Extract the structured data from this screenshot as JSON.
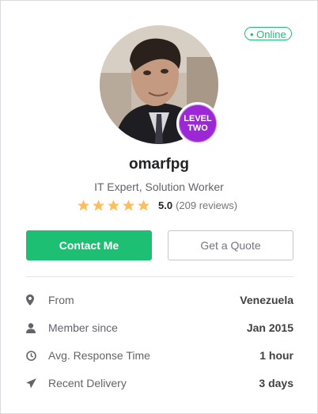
{
  "profile": {
    "status": "• Online",
    "level_line1": "LEVEL",
    "level_line2": "TWO",
    "username": "omarfpg",
    "tagline": "IT Expert, Solution Worker",
    "rating_score": "5.0",
    "rating_reviews": "(209 reviews)",
    "stars": 5,
    "star_color": "#ffbe5b",
    "accent_color": "#1dbf73",
    "level_color": "#9b27d5"
  },
  "actions": {
    "contact_label": "Contact Me",
    "quote_label": "Get a Quote"
  },
  "stats": [
    {
      "icon": "location-pin-icon",
      "label": "From",
      "value": "Venezuela"
    },
    {
      "icon": "user-icon",
      "label": "Member since",
      "value": "Jan 2015"
    },
    {
      "icon": "clock-icon",
      "label": "Avg. Response Time",
      "value": "1 hour"
    },
    {
      "icon": "paper-plane-icon",
      "label": "Recent Delivery",
      "value": "3 days"
    }
  ]
}
